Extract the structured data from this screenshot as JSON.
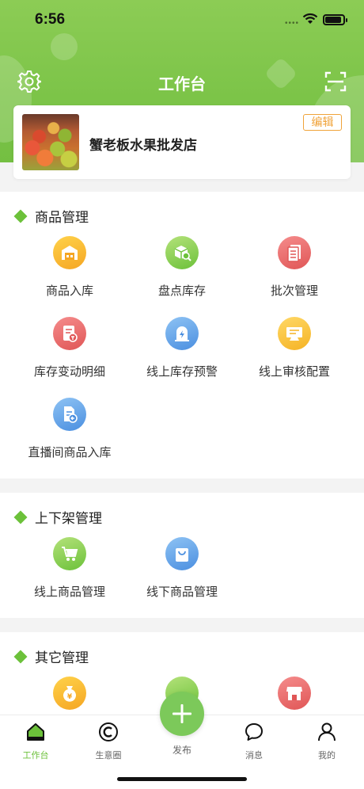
{
  "status_bar": {
    "time": "6:56"
  },
  "header": {
    "title": "工作台"
  },
  "store": {
    "name": "蟹老板水果批发店",
    "edit_label": "编辑"
  },
  "sections": [
    {
      "title": "商品管理",
      "items": [
        {
          "label": "商品入库",
          "icon": "warehouse-icon",
          "color": "#f5a623"
        },
        {
          "label": "盘点库存",
          "icon": "inventory-search-icon",
          "color": "#6cc13a"
        },
        {
          "label": "批次管理",
          "icon": "batch-list-icon",
          "color": "#e05656"
        },
        {
          "label": "库存变动明细",
          "icon": "stock-change-icon",
          "color": "#e05656"
        },
        {
          "label": "线上库存预警",
          "icon": "alert-bell-icon",
          "color": "#4b8fe0"
        },
        {
          "label": "线上审核配置",
          "icon": "review-config-icon",
          "color": "#f5b324"
        },
        {
          "label": "直播间商品入库",
          "icon": "live-product-icon",
          "color": "#4b8fe0"
        }
      ]
    },
    {
      "title": "上下架管理",
      "items": [
        {
          "label": "线上商品管理",
          "icon": "cart-icon",
          "color": "#6cc13a"
        },
        {
          "label": "线下商品管理",
          "icon": "shopping-bag-icon",
          "color": "#4b8fe0"
        }
      ]
    },
    {
      "title": "其它管理",
      "items": [
        {
          "label": "",
          "icon": "money-bag-icon",
          "color": "#f5a623"
        },
        {
          "label": "",
          "icon": "green-circle-icon",
          "color": "#6cc13a"
        },
        {
          "label": "",
          "icon": "storefront-icon",
          "color": "#e05656"
        }
      ]
    }
  ],
  "tabbar": {
    "tabs": [
      {
        "label": "工作台",
        "icon": "home-icon",
        "active": true
      },
      {
        "label": "生意圈",
        "icon": "copyright-circle-icon",
        "active": false
      },
      {
        "label": "发布",
        "icon": "plus-icon",
        "active": false
      },
      {
        "label": "消息",
        "icon": "chat-bubble-icon",
        "active": false
      },
      {
        "label": "我的",
        "icon": "user-icon",
        "active": false
      }
    ]
  },
  "colors": {
    "brand_green": "#6cc13a",
    "accent_orange": "#f0a33a"
  }
}
